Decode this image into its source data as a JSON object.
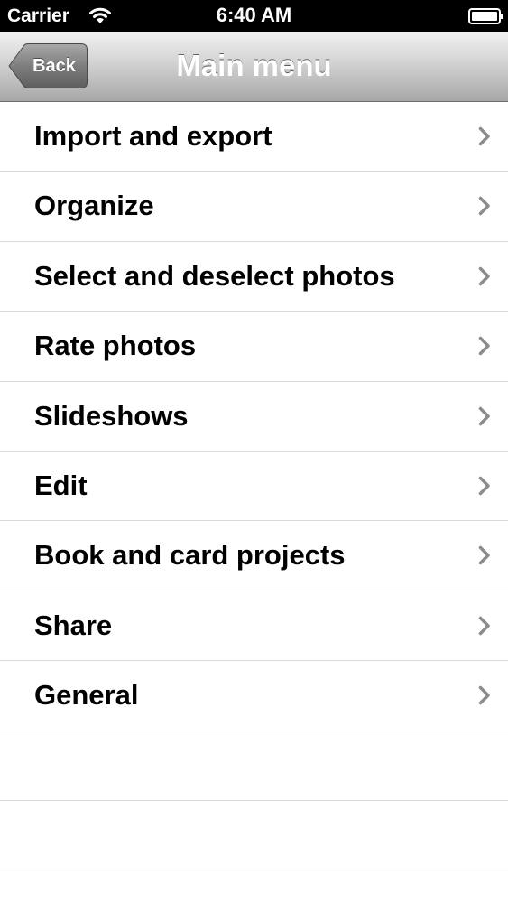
{
  "status_bar": {
    "carrier": "Carrier",
    "time": "6:40 AM",
    "wifi_icon": "wifi-icon",
    "battery_icon": "battery-full-icon"
  },
  "nav_bar": {
    "back_label": "Back",
    "title": "Main menu"
  },
  "menu": {
    "items": [
      {
        "label": "Import and export"
      },
      {
        "label": "Organize"
      },
      {
        "label": "Select and deselect photos"
      },
      {
        "label": "Rate photos"
      },
      {
        "label": "Slideshows"
      },
      {
        "label": "Edit"
      },
      {
        "label": "Book and card projects"
      },
      {
        "label": "Share"
      },
      {
        "label": "General"
      }
    ],
    "chevron_icon": "chevron-right-icon"
  },
  "colors": {
    "status_bar_bg": "#000000",
    "nav_gradient_top": "#f2f2f2",
    "nav_gradient_bottom": "#a7a7a7",
    "separator": "#d9d9d9",
    "chevron": "#8c8c8c"
  }
}
